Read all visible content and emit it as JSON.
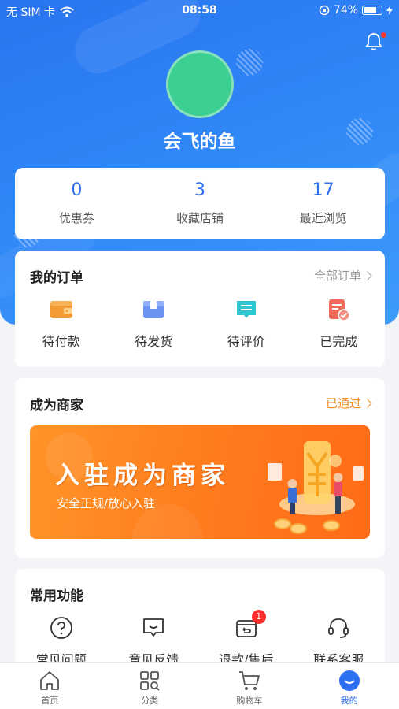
{
  "status_bar": {
    "carrier": "无 SIM 卡",
    "time": "08:58",
    "battery": "74%"
  },
  "profile": {
    "username": "会飞的鱼"
  },
  "stats": [
    {
      "value": "0",
      "label": "优惠券"
    },
    {
      "value": "3",
      "label": "收藏店铺"
    },
    {
      "value": "17",
      "label": "最近浏览"
    }
  ],
  "orders": {
    "title": "我的订单",
    "link": "全部订单",
    "items": [
      {
        "label": "待付款",
        "icon": "wallet-icon"
      },
      {
        "label": "待发货",
        "icon": "package-icon"
      },
      {
        "label": "待评价",
        "icon": "comment-icon"
      },
      {
        "label": "已完成",
        "icon": "completed-doc-icon"
      }
    ]
  },
  "merchant": {
    "title": "成为商家",
    "status": "已通过",
    "banner_title": "入驻成为商家",
    "banner_subtitle": "安全正规/放心入驻"
  },
  "common": {
    "title": "常用功能",
    "items": [
      {
        "label": "常见问题",
        "icon": "question-icon"
      },
      {
        "label": "意见反馈",
        "icon": "feedback-icon"
      },
      {
        "label": "退款/售后",
        "icon": "refund-icon",
        "badge": "1"
      },
      {
        "label": "联系客服",
        "icon": "headset-icon"
      }
    ]
  },
  "tabbar": [
    {
      "label": "首页",
      "icon": "home-icon"
    },
    {
      "label": "分类",
      "icon": "category-icon"
    },
    {
      "label": "购物车",
      "icon": "cart-icon"
    },
    {
      "label": "我的",
      "icon": "profile-icon",
      "active": true
    }
  ],
  "colors": {
    "primary": "#2c6ff0",
    "accent_orange": "#ff8a1e",
    "avatar": "#3ccf92"
  }
}
